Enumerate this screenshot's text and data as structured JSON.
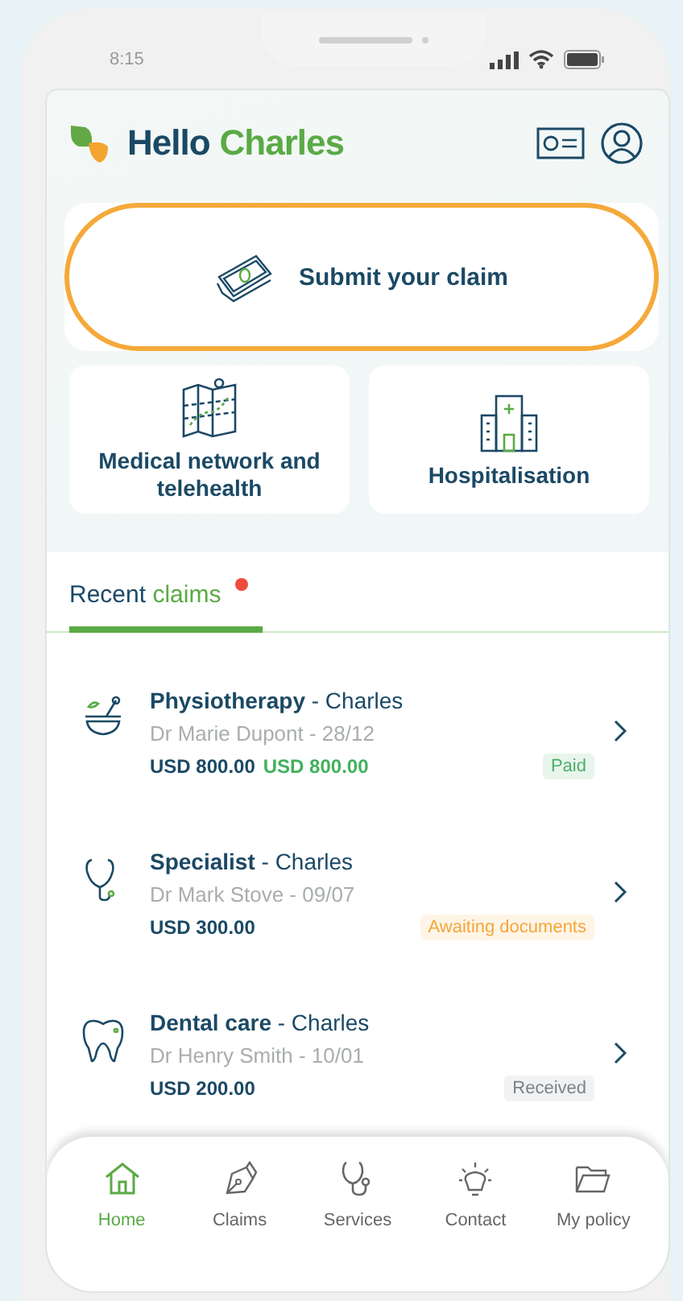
{
  "status_bar": {
    "time": "8:15"
  },
  "header": {
    "greeting": "Hello",
    "name": "Charles"
  },
  "submit_claim": {
    "label": "Submit your claim",
    "highlighted": true
  },
  "tiles": [
    {
      "kind": "map",
      "label": "Medical network and telehealth"
    },
    {
      "kind": "hospital",
      "label": "Hospitalisation"
    }
  ],
  "tabs": [
    {
      "label": "Recent",
      "label_accent": "claims",
      "selected": true,
      "notification": true
    }
  ],
  "claims": [
    {
      "kind": "physio",
      "title": "**Physiotherapy** - Charles",
      "doctor": "Dr Marie Dupont - 28/12",
      "amount": "USD 800.00",
      "reimbursed": "USD 800.00",
      "status": {
        "kind": "paid",
        "label": "Paid"
      }
    },
    {
      "kind": "specialist",
      "title": "**Specialist** - Charles",
      "doctor": "Dr Mark Stove - 09/07",
      "amount": "USD 300.00",
      "status": {
        "kind": "awaiting",
        "label": "Awaiting documents"
      }
    },
    {
      "kind": "dental",
      "title": "**Dental care** - Charles",
      "doctor": "Dr Henry Smith - 10/01",
      "amount": "USD 200.00",
      "status": {
        "kind": "received",
        "label": "Received"
      }
    }
  ],
  "nav": [
    {
      "kind": "home",
      "label": "Home",
      "selected": true
    },
    {
      "kind": "claims",
      "label": "Claims",
      "selected": false
    },
    {
      "kind": "services",
      "label": "Services",
      "selected": false
    },
    {
      "kind": "contact",
      "label": "Contact",
      "selected": false
    },
    {
      "kind": "policy",
      "label": "My policy",
      "selected": false
    }
  ]
}
